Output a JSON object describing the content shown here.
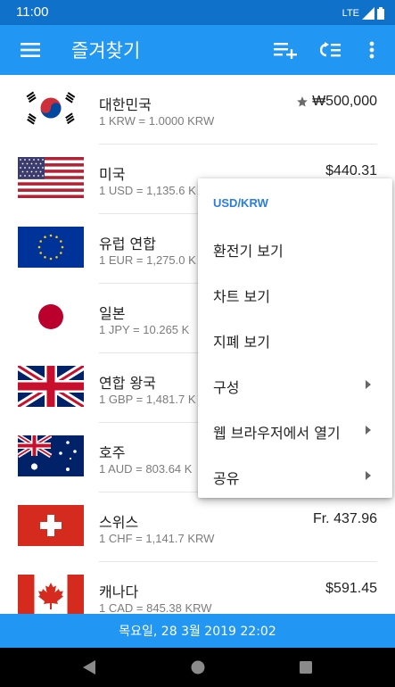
{
  "status_bar": {
    "time": "11:00",
    "network": "LTE"
  },
  "app_bar": {
    "title": "즐겨찾기",
    "icons": [
      "menu-icon",
      "add-to-list-icon",
      "reorder-list-icon",
      "more-vert-icon"
    ]
  },
  "currencies": [
    {
      "flag": "south-korea-flag",
      "name": "대한민국",
      "rate": "1 KRW = 1.0000 KRW",
      "value": "₩500,000",
      "starred": true
    },
    {
      "flag": "usa-flag",
      "name": "미국",
      "rate": "1 USD = 1,135.6 K",
      "value": "$440.31",
      "starred": false
    },
    {
      "flag": "eu-flag",
      "name": "유럽 연합",
      "rate": "1 EUR = 1,275.0 K",
      "value": "",
      "starred": false
    },
    {
      "flag": "japan-flag",
      "name": "일본",
      "rate": "1 JPY = 10.265 K",
      "value": "",
      "starred": false
    },
    {
      "flag": "uk-flag",
      "name": "연합 왕국",
      "rate": "1 GBP = 1,481.7 K",
      "value": "",
      "starred": false
    },
    {
      "flag": "australia-flag",
      "name": "호주",
      "rate": "1 AUD = 803.64 K",
      "value": "",
      "starred": false
    },
    {
      "flag": "switzerland-flag",
      "name": "스위스",
      "rate": "1 CHF = 1,141.7 KRW",
      "value": "Fr. 437.96",
      "starred": false
    },
    {
      "flag": "canada-flag",
      "name": "캐나다",
      "rate": "1 CAD = 845.38 KRW",
      "value": "$591.45",
      "starred": false
    }
  ],
  "date_bar": {
    "text": "목요일, 28 3월 2019 22:02"
  },
  "popup_menu": {
    "header": "USD/KRW",
    "items": [
      {
        "label": "환전기 보기",
        "has_submenu": false
      },
      {
        "label": "차트 보기",
        "has_submenu": false
      },
      {
        "label": "지폐 보기",
        "has_submenu": false
      },
      {
        "label": "구성",
        "has_submenu": true
      },
      {
        "label": "웹 브라우저에서 열기",
        "has_submenu": true
      },
      {
        "label": "공유",
        "has_submenu": true
      }
    ]
  },
  "colors": {
    "primary": "#2196f3",
    "status_bar": "#0f71c9",
    "accent_text": "#2a7de1"
  }
}
